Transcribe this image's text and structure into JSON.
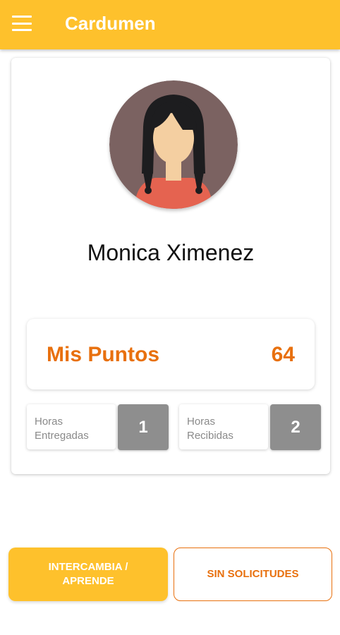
{
  "header": {
    "title": "Cardumen",
    "menu_icon": "hamburger-menu-icon",
    "background_color": "#fec12c"
  },
  "profile": {
    "avatar_icon": "girl-avatar-icon",
    "name": "Monica Ximenez"
  },
  "points": {
    "label": "Mis Puntos",
    "value": "64",
    "color": "#e8700e"
  },
  "stats": [
    {
      "label": "Horas Entregadas",
      "value": "1"
    },
    {
      "label": "Horas Recibidas",
      "value": "2"
    }
  ],
  "actions": {
    "primary_label": "INTERCAMBIA / APRENDE",
    "secondary_label": "SIN SOLICITUDES"
  }
}
